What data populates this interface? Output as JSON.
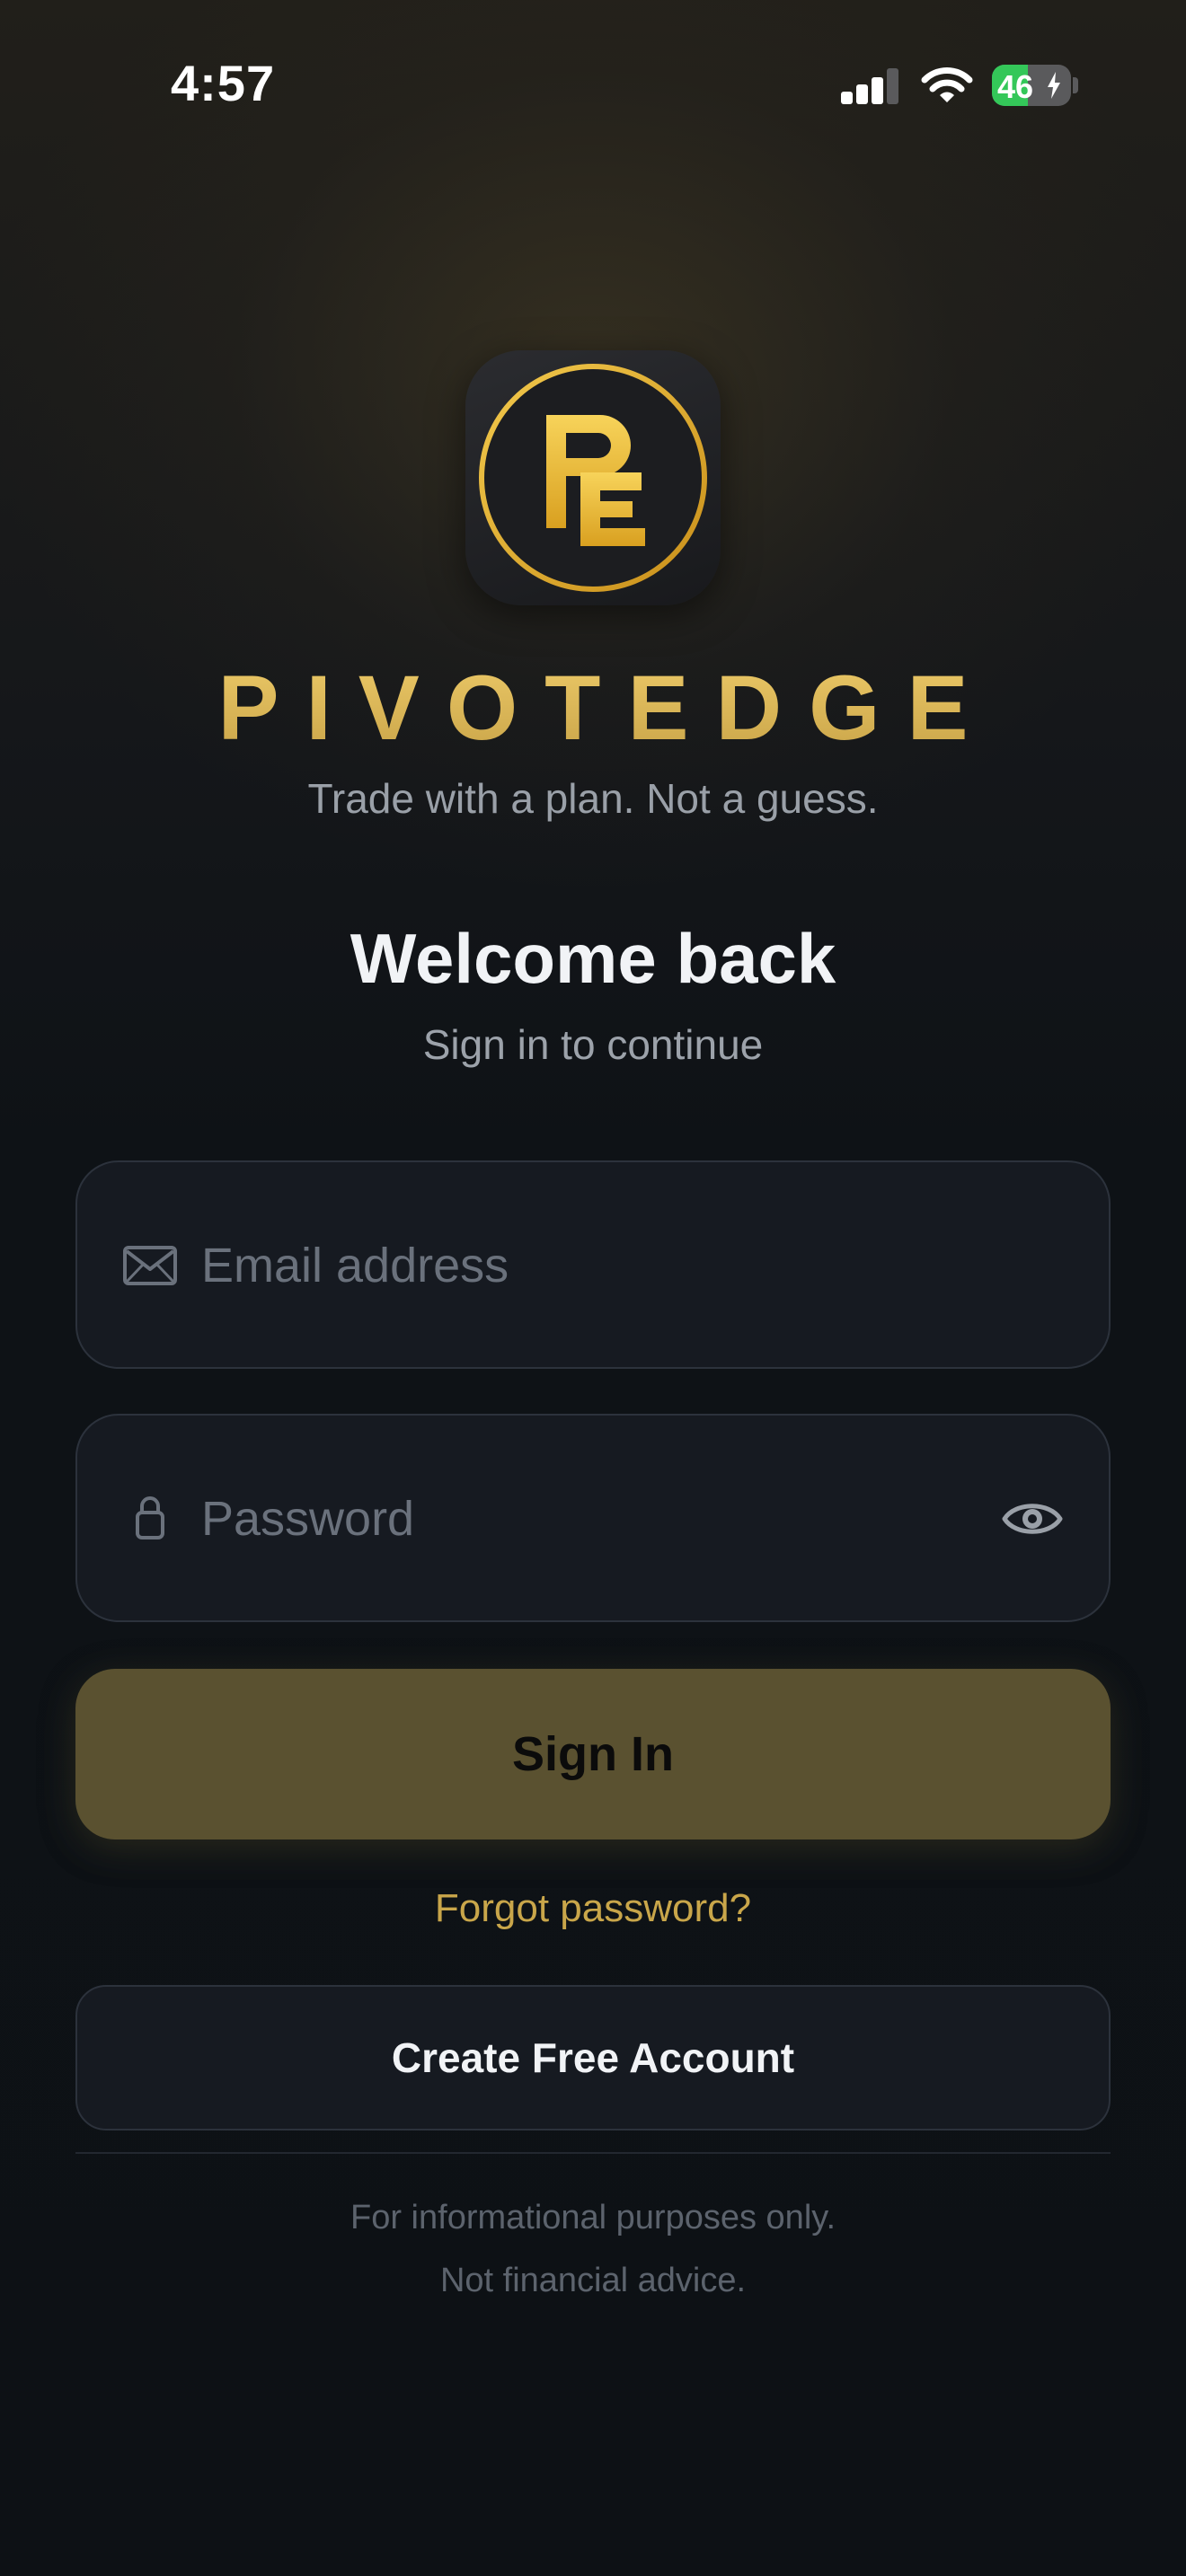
{
  "status_bar": {
    "time": "4:57",
    "battery_level": "46",
    "icons": [
      "cellular-signal-icon",
      "wifi-icon",
      "battery-charging-icon"
    ]
  },
  "brand": {
    "logo_monogram": "PE",
    "name": "PIVOTEDGE",
    "tagline": "Trade with a plan. Not a guess."
  },
  "header": {
    "title": "Welcome back",
    "subtitle": "Sign in to continue"
  },
  "form": {
    "email": {
      "placeholder": "Email address",
      "value": "",
      "icon": "envelope-icon"
    },
    "password": {
      "placeholder": "Password",
      "value": "",
      "icon": "lock-icon",
      "toggle_icon": "eye-icon"
    },
    "signin_label": "Sign In",
    "forgot_label": "Forgot password?",
    "create_account_label": "Create Free Account"
  },
  "footer": {
    "line1": "For informational purposes only.",
    "line2": "Not financial advice."
  },
  "colors": {
    "accent_gold": "#d4b251",
    "signin_button": "#5a5130",
    "background": "#0d1014",
    "battery_green": "#34c759"
  }
}
